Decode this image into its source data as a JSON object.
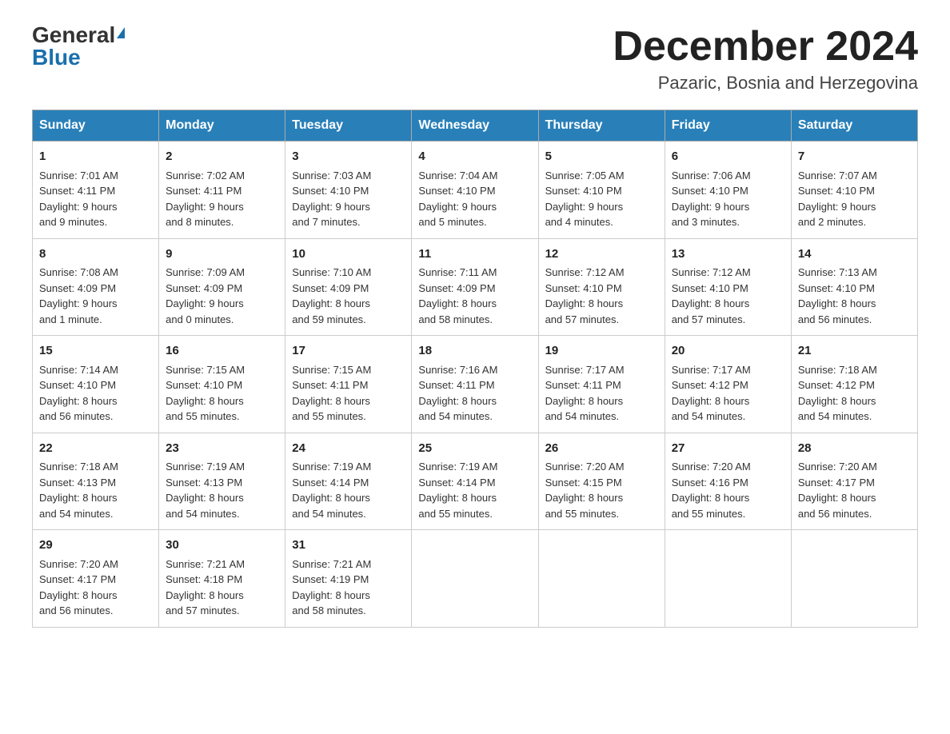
{
  "logo": {
    "general": "General",
    "blue": "Blue"
  },
  "header": {
    "month": "December 2024",
    "location": "Pazaric, Bosnia and Herzegovina"
  },
  "weekdays": [
    "Sunday",
    "Monday",
    "Tuesday",
    "Wednesday",
    "Thursday",
    "Friday",
    "Saturday"
  ],
  "weeks": [
    [
      {
        "day": "1",
        "info": "Sunrise: 7:01 AM\nSunset: 4:11 PM\nDaylight: 9 hours\nand 9 minutes."
      },
      {
        "day": "2",
        "info": "Sunrise: 7:02 AM\nSunset: 4:11 PM\nDaylight: 9 hours\nand 8 minutes."
      },
      {
        "day": "3",
        "info": "Sunrise: 7:03 AM\nSunset: 4:10 PM\nDaylight: 9 hours\nand 7 minutes."
      },
      {
        "day": "4",
        "info": "Sunrise: 7:04 AM\nSunset: 4:10 PM\nDaylight: 9 hours\nand 5 minutes."
      },
      {
        "day": "5",
        "info": "Sunrise: 7:05 AM\nSunset: 4:10 PM\nDaylight: 9 hours\nand 4 minutes."
      },
      {
        "day": "6",
        "info": "Sunrise: 7:06 AM\nSunset: 4:10 PM\nDaylight: 9 hours\nand 3 minutes."
      },
      {
        "day": "7",
        "info": "Sunrise: 7:07 AM\nSunset: 4:10 PM\nDaylight: 9 hours\nand 2 minutes."
      }
    ],
    [
      {
        "day": "8",
        "info": "Sunrise: 7:08 AM\nSunset: 4:09 PM\nDaylight: 9 hours\nand 1 minute."
      },
      {
        "day": "9",
        "info": "Sunrise: 7:09 AM\nSunset: 4:09 PM\nDaylight: 9 hours\nand 0 minutes."
      },
      {
        "day": "10",
        "info": "Sunrise: 7:10 AM\nSunset: 4:09 PM\nDaylight: 8 hours\nand 59 minutes."
      },
      {
        "day": "11",
        "info": "Sunrise: 7:11 AM\nSunset: 4:09 PM\nDaylight: 8 hours\nand 58 minutes."
      },
      {
        "day": "12",
        "info": "Sunrise: 7:12 AM\nSunset: 4:10 PM\nDaylight: 8 hours\nand 57 minutes."
      },
      {
        "day": "13",
        "info": "Sunrise: 7:12 AM\nSunset: 4:10 PM\nDaylight: 8 hours\nand 57 minutes."
      },
      {
        "day": "14",
        "info": "Sunrise: 7:13 AM\nSunset: 4:10 PM\nDaylight: 8 hours\nand 56 minutes."
      }
    ],
    [
      {
        "day": "15",
        "info": "Sunrise: 7:14 AM\nSunset: 4:10 PM\nDaylight: 8 hours\nand 56 minutes."
      },
      {
        "day": "16",
        "info": "Sunrise: 7:15 AM\nSunset: 4:10 PM\nDaylight: 8 hours\nand 55 minutes."
      },
      {
        "day": "17",
        "info": "Sunrise: 7:15 AM\nSunset: 4:11 PM\nDaylight: 8 hours\nand 55 minutes."
      },
      {
        "day": "18",
        "info": "Sunrise: 7:16 AM\nSunset: 4:11 PM\nDaylight: 8 hours\nand 54 minutes."
      },
      {
        "day": "19",
        "info": "Sunrise: 7:17 AM\nSunset: 4:11 PM\nDaylight: 8 hours\nand 54 minutes."
      },
      {
        "day": "20",
        "info": "Sunrise: 7:17 AM\nSunset: 4:12 PM\nDaylight: 8 hours\nand 54 minutes."
      },
      {
        "day": "21",
        "info": "Sunrise: 7:18 AM\nSunset: 4:12 PM\nDaylight: 8 hours\nand 54 minutes."
      }
    ],
    [
      {
        "day": "22",
        "info": "Sunrise: 7:18 AM\nSunset: 4:13 PM\nDaylight: 8 hours\nand 54 minutes."
      },
      {
        "day": "23",
        "info": "Sunrise: 7:19 AM\nSunset: 4:13 PM\nDaylight: 8 hours\nand 54 minutes."
      },
      {
        "day": "24",
        "info": "Sunrise: 7:19 AM\nSunset: 4:14 PM\nDaylight: 8 hours\nand 54 minutes."
      },
      {
        "day": "25",
        "info": "Sunrise: 7:19 AM\nSunset: 4:14 PM\nDaylight: 8 hours\nand 55 minutes."
      },
      {
        "day": "26",
        "info": "Sunrise: 7:20 AM\nSunset: 4:15 PM\nDaylight: 8 hours\nand 55 minutes."
      },
      {
        "day": "27",
        "info": "Sunrise: 7:20 AM\nSunset: 4:16 PM\nDaylight: 8 hours\nand 55 minutes."
      },
      {
        "day": "28",
        "info": "Sunrise: 7:20 AM\nSunset: 4:17 PM\nDaylight: 8 hours\nand 56 minutes."
      }
    ],
    [
      {
        "day": "29",
        "info": "Sunrise: 7:20 AM\nSunset: 4:17 PM\nDaylight: 8 hours\nand 56 minutes."
      },
      {
        "day": "30",
        "info": "Sunrise: 7:21 AM\nSunset: 4:18 PM\nDaylight: 8 hours\nand 57 minutes."
      },
      {
        "day": "31",
        "info": "Sunrise: 7:21 AM\nSunset: 4:19 PM\nDaylight: 8 hours\nand 58 minutes."
      },
      null,
      null,
      null,
      null
    ]
  ]
}
